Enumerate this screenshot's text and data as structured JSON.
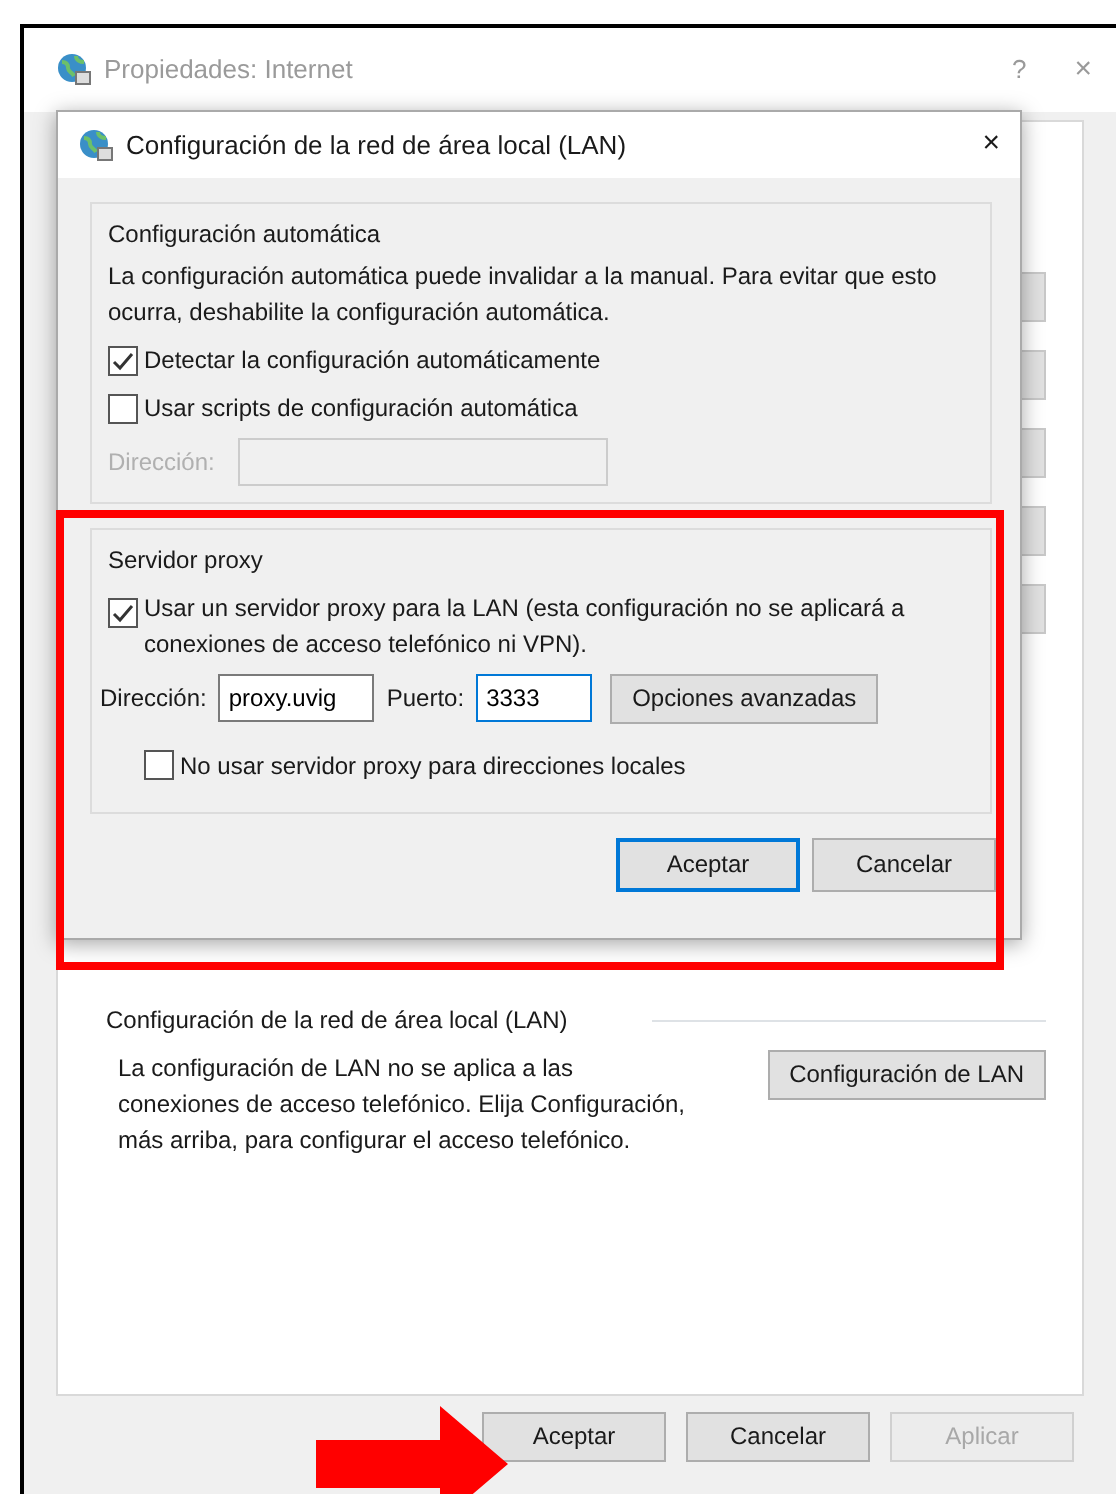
{
  "parent_window": {
    "title": "Propiedades: Internet",
    "help": "?",
    "close": "×",
    "lan_section": {
      "heading": "Configuración de la red de área local (LAN)",
      "text": "La configuración de LAN no se aplica a las conexiones de acceso telefónico. Elija Configuración, más arriba, para configurar el acceso telefónico.",
      "button": "Configuración de LAN"
    },
    "buttons": [
      {
        "label": "Aceptar",
        "disabled": false
      },
      {
        "label": "Cancelar",
        "disabled": false
      },
      {
        "label": "Aplicar",
        "disabled": true
      }
    ]
  },
  "dialog": {
    "title": "Configuración de la red de área local (LAN)",
    "close": "×",
    "auto_config": {
      "heading": "Configuración automática",
      "text": "La configuración automática puede invalidar a la manual. Para evitar que esto ocurra, deshabilite la configuración automática.",
      "options": [
        {
          "label": "Detectar la configuración automáticamente",
          "checked": true
        },
        {
          "label": "Usar scripts de configuración automática",
          "checked": false
        }
      ],
      "address": {
        "label": "Dirección:",
        "disabled": true
      }
    },
    "proxy": {
      "heading": "Servidor proxy",
      "use_proxy": {
        "label": "Usar un servidor proxy para la LAN (esta configuración no se aplicará a conexiones de acceso telefónico ni VPN).",
        "checked": true
      },
      "address_label": "Dirección:",
      "address_value": "proxy.uvig",
      "port_label": "Puerto:",
      "port_value": "3333",
      "advanced_button": "Opciones avanzadas",
      "bypass_local": {
        "label": "No usar servidor proxy para direcciones locales",
        "checked": false
      }
    },
    "buttons": [
      {
        "label": "Aceptar",
        "default": true
      },
      {
        "label": "Cancelar",
        "default": false
      }
    ]
  },
  "annotations": {
    "highlight_box": true,
    "pointer_arrow": true
  }
}
